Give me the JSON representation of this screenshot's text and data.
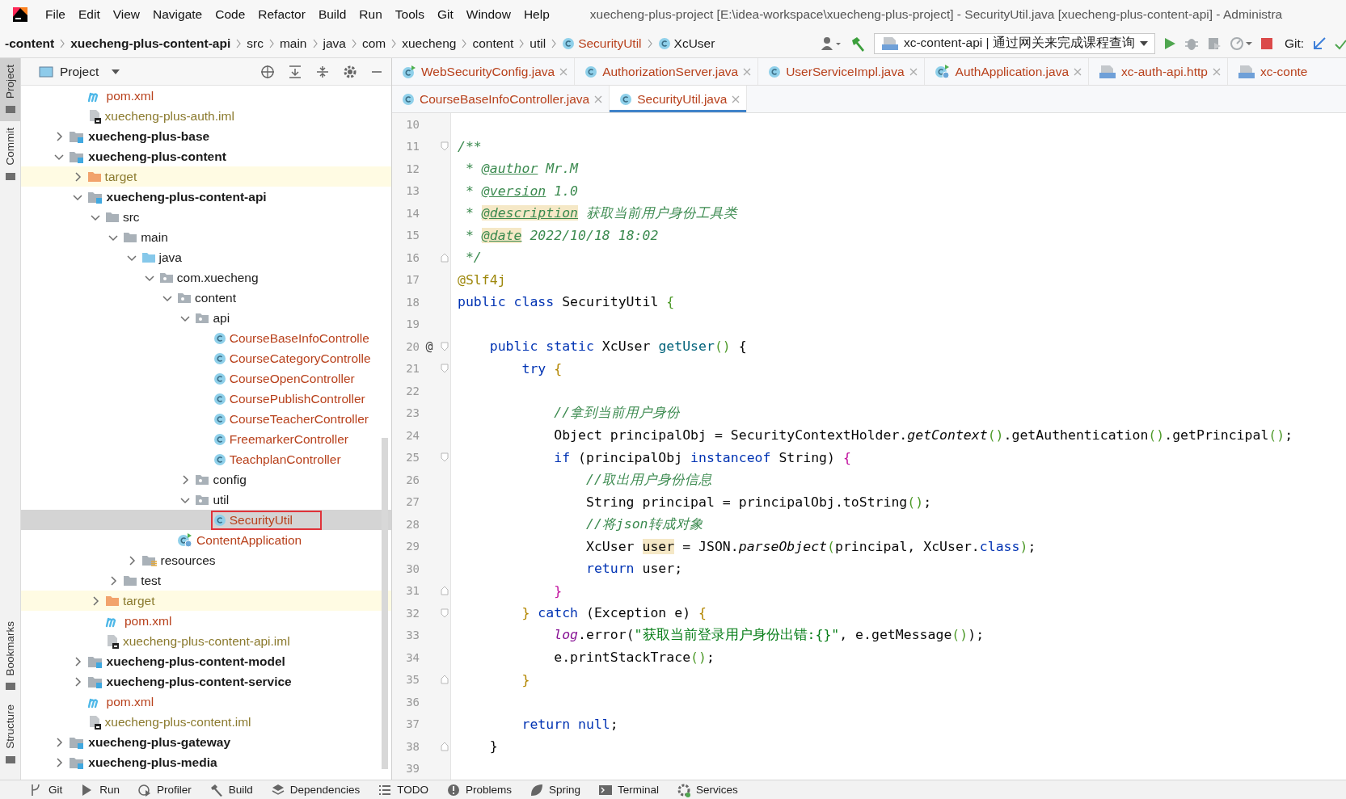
{
  "menubar": {
    "menus": [
      "File",
      "Edit",
      "View",
      "Navigate",
      "Code",
      "Refactor",
      "Build",
      "Run",
      "Tools",
      "Git",
      "Window",
      "Help"
    ],
    "title": "xuecheng-plus-project [E:\\idea-workspace\\xuecheng-plus-project] - SecurityUtil.java [xuecheng-plus-content-api] - Administra"
  },
  "navbar": {
    "crumbs": [
      {
        "label": "-content",
        "kind": "module"
      },
      {
        "label": "xuecheng-plus-content-api",
        "kind": "module"
      },
      {
        "label": "src",
        "kind": "folder"
      },
      {
        "label": "main",
        "kind": "folder"
      },
      {
        "label": "java",
        "kind": "folder"
      },
      {
        "label": "com",
        "kind": "folder"
      },
      {
        "label": "xuecheng",
        "kind": "folder"
      },
      {
        "label": "content",
        "kind": "folder"
      },
      {
        "label": "util",
        "kind": "folder"
      },
      {
        "label": "SecurityUtil",
        "kind": "class",
        "unversioned": true
      },
      {
        "label": "XcUser",
        "kind": "class",
        "unversioned": false
      }
    ],
    "run_config": "xc-content-api | 通过网关来完成课程查询",
    "git_label": "Git:"
  },
  "side_tabs": {
    "top": [
      {
        "label": "Project",
        "selected": true
      },
      {
        "label": "Commit",
        "selected": false
      }
    ],
    "bottom": [
      {
        "label": "Bookmarks",
        "selected": false
      },
      {
        "label": "Structure",
        "selected": false
      }
    ]
  },
  "project": {
    "title": "Project",
    "tree": [
      {
        "children": [
          {
            "label": "pom.xml",
            "kind": "maven"
          },
          {
            "label": "xuecheng-plus-auth.iml",
            "kind": "iml"
          }
        ]
      },
      {
        "label": "xuecheng-plus-base",
        "kind": "module",
        "expanded": false
      },
      {
        "label": "xuecheng-plus-content",
        "kind": "module",
        "expanded": true,
        "children": [
          {
            "label": "target",
            "kind": "excluded",
            "expanded": false
          },
          {
            "label": "xuecheng-plus-content-api",
            "kind": "module",
            "expanded": true,
            "children": [
              {
                "label": "src",
                "kind": "folder",
                "expanded": true,
                "children": [
                  {
                    "label": "main",
                    "kind": "folder",
                    "expanded": true,
                    "children": [
                      {
                        "label": "java",
                        "kind": "source",
                        "expanded": true,
                        "children": [
                          {
                            "label": "com.xuecheng",
                            "kind": "package",
                            "expanded": true,
                            "children": [
                              {
                                "label": "content",
                                "kind": "package",
                                "expanded": true,
                                "children": [
                                  {
                                    "label": "api",
                                    "kind": "package",
                                    "expanded": true,
                                    "children": [
                                      {
                                        "label": "CourseBaseInfoControlle",
                                        "kind": "class"
                                      },
                                      {
                                        "label": "CourseCategoryControlle",
                                        "kind": "class"
                                      },
                                      {
                                        "label": "CourseOpenController",
                                        "kind": "class"
                                      },
                                      {
                                        "label": "CoursePublishController",
                                        "kind": "class"
                                      },
                                      {
                                        "label": "CourseTeacherController",
                                        "kind": "class"
                                      },
                                      {
                                        "label": "FreemarkerController",
                                        "kind": "class"
                                      },
                                      {
                                        "label": "TeachplanController",
                                        "kind": "class"
                                      }
                                    ]
                                  },
                                  {
                                    "label": "config",
                                    "kind": "package",
                                    "expanded": false
                                  },
                                  {
                                    "label": "util",
                                    "kind": "package",
                                    "expanded": true,
                                    "children": [
                                      {
                                        "label": "SecurityUtil",
                                        "kind": "class",
                                        "selected": true,
                                        "boxed": true
                                      }
                                    ]
                                  }
                                ]
                              },
                              {
                                "label": "ContentApplication",
                                "kind": "app"
                              }
                            ]
                          }
                        ]
                      },
                      {
                        "label": "resources",
                        "kind": "resources",
                        "expanded": false
                      }
                    ]
                  },
                  {
                    "label": "test",
                    "kind": "folder",
                    "expanded": false
                  }
                ]
              },
              {
                "label": "target",
                "kind": "excluded",
                "expanded": false
              },
              {
                "label": "pom.xml",
                "kind": "maven"
              },
              {
                "label": "xuecheng-plus-content-api.iml",
                "kind": "iml"
              }
            ]
          },
          {
            "label": "xuecheng-plus-content-model",
            "kind": "module",
            "expanded": false
          },
          {
            "label": "xuecheng-plus-content-service",
            "kind": "module",
            "expanded": false
          },
          {
            "label": "pom.xml",
            "kind": "maven"
          },
          {
            "label": "xuecheng-plus-content.iml",
            "kind": "iml"
          }
        ]
      },
      {
        "label": "xuecheng-plus-gateway",
        "kind": "module",
        "expanded": false
      },
      {
        "label": "xuecheng-plus-media",
        "kind": "module",
        "expanded": false
      }
    ]
  },
  "tab_rows": [
    [
      {
        "label": "WebSecurityConfig.java",
        "kind": "config",
        "selected": false
      },
      {
        "label": "AuthorizationServer.java",
        "kind": "class",
        "selected": false
      },
      {
        "label": "UserServiceImpl.java",
        "kind": "class",
        "selected": false
      },
      {
        "label": "AuthApplication.java",
        "kind": "app",
        "selected": false
      },
      {
        "label": "xc-auth-api.http",
        "kind": "http",
        "selected": false
      },
      {
        "label": "xc-conte",
        "kind": "http",
        "selected": false,
        "cut": true
      }
    ],
    [
      {
        "label": "CourseBaseInfoController.java",
        "kind": "class",
        "selected": false
      },
      {
        "label": "SecurityUtil.java",
        "kind": "class",
        "selected": true
      }
    ]
  ],
  "editor": {
    "lines": [
      {
        "n": "10",
        "kind": "plain"
      },
      {
        "n": "11",
        "kind": "fold-start",
        "tokens": [
          {
            "text": "/**",
            "kind": "doc"
          }
        ]
      },
      {
        "n": "12",
        "kind": "plain",
        "tokens": [
          {
            "text": " * ",
            "kind": "doc"
          },
          {
            "text": "@author",
            "kind": "doctag"
          },
          {
            "text": " Mr.M",
            "kind": "doc"
          }
        ]
      },
      {
        "n": "13",
        "kind": "plain",
        "tokens": [
          {
            "text": " * ",
            "kind": "doc"
          },
          {
            "text": "@version",
            "kind": "doctag"
          },
          {
            "text": " 1.0",
            "kind": "doc"
          }
        ]
      },
      {
        "n": "14",
        "kind": "plain",
        "tokens": [
          {
            "text": " * ",
            "kind": "doc"
          },
          {
            "text": "@description",
            "kind": "doctag-hl"
          },
          {
            "text": " 获取当前用户身份工具类",
            "kind": "doc"
          }
        ]
      },
      {
        "n": "15",
        "kind": "plain",
        "tokens": [
          {
            "text": " * ",
            "kind": "doc"
          },
          {
            "text": "@date",
            "kind": "doctag-hl"
          },
          {
            "text": " 2022/10/18 18:02",
            "kind": "doc"
          }
        ]
      },
      {
        "n": "16",
        "kind": "fold-end",
        "tokens": [
          {
            "text": " */",
            "kind": "doc"
          }
        ]
      },
      {
        "n": "17",
        "kind": "plain",
        "tokens": [
          {
            "text": "@Slf4j",
            "kind": "annot"
          }
        ]
      },
      {
        "n": "18",
        "kind": "plain",
        "tokens": [
          {
            "text": "public class ",
            "kind": "kw"
          },
          {
            "text": "SecurityUtil ",
            "kind": "plain"
          },
          {
            "text": "{",
            "kind": "b1"
          }
        ]
      },
      {
        "n": "19",
        "kind": "plain"
      },
      {
        "n": "20",
        "kind": "fold-start",
        "mark": "@",
        "tokens": [
          {
            "text": "    public static ",
            "kind": "kw"
          },
          {
            "text": "XcUser ",
            "kind": "plain"
          },
          {
            "text": "getUser",
            "kind": "method"
          },
          {
            "text": "()",
            "kind": "b1"
          },
          {
            "text": " {",
            "kind": "plain"
          }
        ]
      },
      {
        "n": "21",
        "kind": "fold-start",
        "tokens": [
          {
            "text": "        try ",
            "kind": "kw"
          },
          {
            "text": "{",
            "kind": "b2"
          }
        ]
      },
      {
        "n": "22",
        "kind": "plain"
      },
      {
        "n": "23",
        "kind": "plain",
        "tokens": [
          {
            "text": "            //拿到当前用户身份",
            "kind": "comment"
          }
        ]
      },
      {
        "n": "24",
        "kind": "plain",
        "tokens": [
          {
            "text": "            Object principalObj = SecurityContextHolder.",
            "kind": "plain"
          },
          {
            "text": "getContext",
            "kind": "static"
          },
          {
            "text": "()",
            "kind": "b1"
          },
          {
            "text": ".getAuthentication",
            "kind": "plain"
          },
          {
            "text": "()",
            "kind": "b1"
          },
          {
            "text": ".getPrincipal",
            "kind": "plain"
          },
          {
            "text": "()",
            "kind": "b1"
          },
          {
            "text": ";",
            "kind": "plain"
          }
        ]
      },
      {
        "n": "25",
        "kind": "fold-start",
        "tokens": [
          {
            "text": "            if ",
            "kind": "kw"
          },
          {
            "text": "(principalObj ",
            "kind": "plain"
          },
          {
            "text": "instanceof",
            "kind": "kw"
          },
          {
            "text": " String) ",
            "kind": "plain"
          },
          {
            "text": "{",
            "kind": "b3"
          }
        ]
      },
      {
        "n": "26",
        "kind": "plain",
        "tokens": [
          {
            "text": "                //取出用户身份信息",
            "kind": "comment"
          }
        ]
      },
      {
        "n": "27",
        "kind": "plain",
        "tokens": [
          {
            "text": "                String principal = principalObj.toString",
            "kind": "plain"
          },
          {
            "text": "()",
            "kind": "b1"
          },
          {
            "text": ";",
            "kind": "plain"
          }
        ]
      },
      {
        "n": "28",
        "kind": "plain",
        "tokens": [
          {
            "text": "                //将json转成对象",
            "kind": "comment"
          }
        ]
      },
      {
        "n": "29",
        "kind": "plain",
        "tokens": [
          {
            "text": "                XcUser ",
            "kind": "plain"
          },
          {
            "text": "user",
            "kind": "var-hl"
          },
          {
            "text": " = JSON.",
            "kind": "plain"
          },
          {
            "text": "parseObject",
            "kind": "static"
          },
          {
            "text": "(",
            "kind": "b1"
          },
          {
            "text": "principal, XcUser.",
            "kind": "plain"
          },
          {
            "text": "class",
            "kind": "kw"
          },
          {
            "text": ")",
            "kind": "b1"
          },
          {
            "text": ";",
            "kind": "plain"
          }
        ]
      },
      {
        "n": "30",
        "kind": "plain",
        "tokens": [
          {
            "text": "                return ",
            "kind": "kw"
          },
          {
            "text": "user;",
            "kind": "plain"
          }
        ]
      },
      {
        "n": "31",
        "kind": "fold-end",
        "tokens": [
          {
            "text": "            }",
            "kind": "b3"
          }
        ]
      },
      {
        "n": "32",
        "kind": "fold-start",
        "tokens": [
          {
            "text": "        }",
            "kind": "b2"
          },
          {
            "text": " catch ",
            "kind": "kw"
          },
          {
            "text": "(Exception e) ",
            "kind": "plain"
          },
          {
            "text": "{",
            "kind": "b2"
          }
        ]
      },
      {
        "n": "33",
        "kind": "plain",
        "tokens": [
          {
            "text": "            log",
            "kind": "field"
          },
          {
            "text": ".error(",
            "kind": "plain"
          },
          {
            "text": "\"获取当前登录用户身份出错:{}\"",
            "kind": "string"
          },
          {
            "text": ", e.getMessage",
            "kind": "plain"
          },
          {
            "text": "()",
            "kind": "b1"
          },
          {
            "text": ");",
            "kind": "plain"
          }
        ]
      },
      {
        "n": "34",
        "kind": "plain",
        "tokens": [
          {
            "text": "            e.printStackTrace",
            "kind": "plain"
          },
          {
            "text": "()",
            "kind": "b1"
          },
          {
            "text": ";",
            "kind": "plain"
          }
        ]
      },
      {
        "n": "35",
        "kind": "fold-end",
        "tokens": [
          {
            "text": "        }",
            "kind": "b2"
          }
        ]
      },
      {
        "n": "36",
        "kind": "plain"
      },
      {
        "n": "37",
        "kind": "plain",
        "tokens": [
          {
            "text": "        return ",
            "kind": "kw"
          },
          {
            "text": "null",
            "kind": "kw"
          },
          {
            "text": ";",
            "kind": "plain"
          }
        ]
      },
      {
        "n": "38",
        "kind": "fold-end",
        "tokens": [
          {
            "text": "    }",
            "kind": "plain"
          }
        ]
      },
      {
        "n": "39",
        "kind": "plain"
      }
    ]
  },
  "toolwindows": [
    {
      "label": "Git"
    },
    {
      "label": "Run"
    },
    {
      "label": "Profiler"
    },
    {
      "label": "Build"
    },
    {
      "label": "Dependencies"
    },
    {
      "label": "TODO"
    },
    {
      "label": "Problems"
    },
    {
      "label": "Spring"
    },
    {
      "label": "Terminal"
    },
    {
      "label": "Services"
    }
  ]
}
